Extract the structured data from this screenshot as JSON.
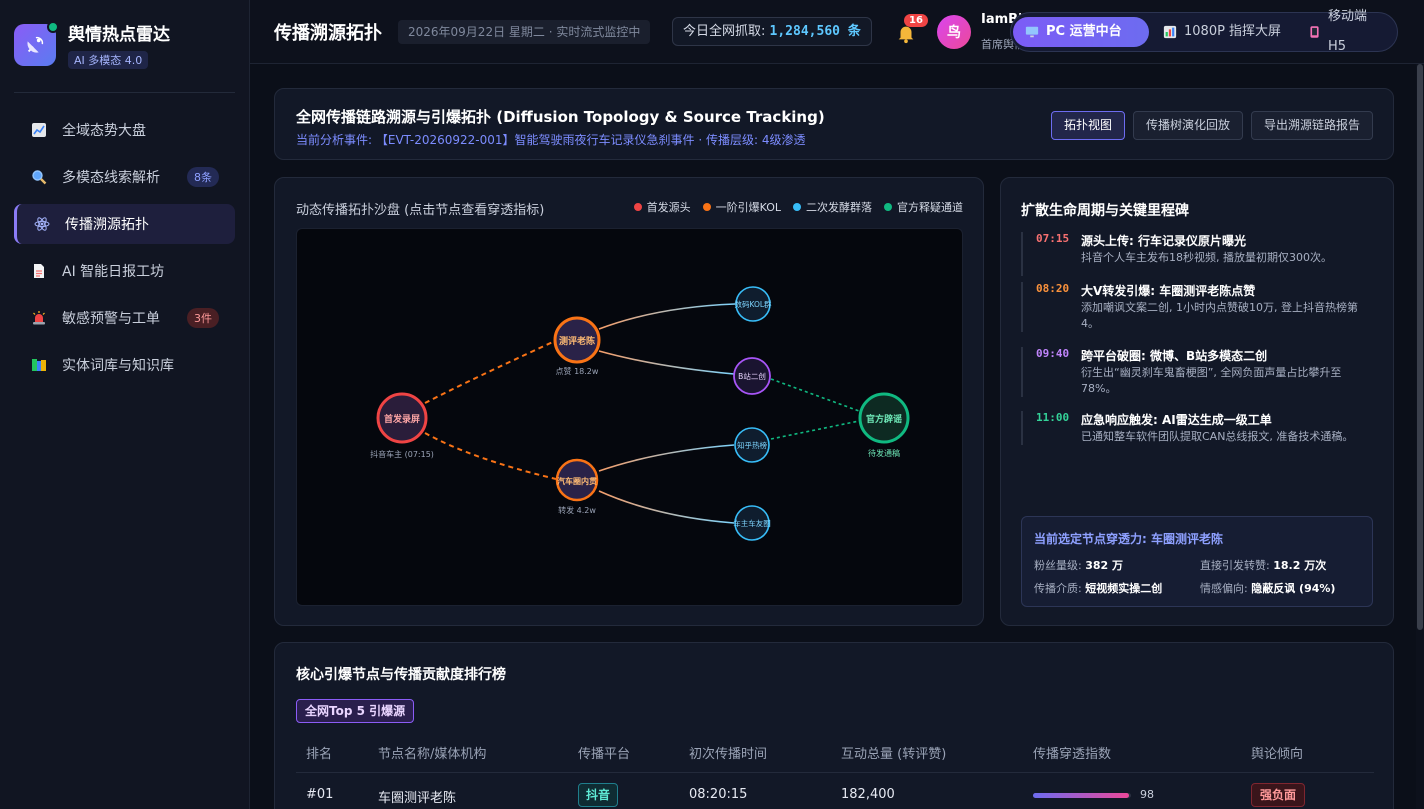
{
  "brand": {
    "title": "舆情热点雷达",
    "badge": "AI 多模态 4.0"
  },
  "nav": [
    {
      "label": "全域态势大盘",
      "icon": "chart-icon",
      "badge": ""
    },
    {
      "label": "多模态线索解析",
      "icon": "magnifier-icon",
      "badge": "8条"
    },
    {
      "label": "传播溯源拓扑",
      "icon": "atom-icon",
      "badge": ""
    },
    {
      "label": "AI 智能日报工坊",
      "icon": "document-icon",
      "badge": ""
    },
    {
      "label": "敏感预警与工单",
      "icon": "siren-icon",
      "badge": "3件"
    },
    {
      "label": "实体词库与知识库",
      "icon": "books-icon",
      "badge": ""
    }
  ],
  "header": {
    "title": "传播溯源拓扑",
    "date": "2026年09月22日 星期二 · 实时流式监控中",
    "count_label": "今日全网抓取:",
    "count_value": "1,284,560 条",
    "bell_count": "16",
    "avatar_text": "鸟",
    "user_name": "IamBird",
    "user_role": "首席舆情分析师"
  },
  "switcher": [
    {
      "label": "PC 运营中台",
      "icon": "monitor-icon"
    },
    {
      "label": "1080P 指挥大屏",
      "icon": "bar-chart-icon"
    },
    {
      "label": "移动端 H5",
      "icon": "phone-icon"
    }
  ],
  "head_card": {
    "title": "全网传播链路溯源与引爆拓扑 (Diffusion Topology & Source Tracking)",
    "subtitle": "当前分析事件: 【EVT-20260922-001】智能驾驶雨夜行车记录仪急刹事件 · 传播层级: 4级渗透",
    "btn_topology": "拓扑视图",
    "btn_replay": "传播树演化回放",
    "btn_export": "导出溯源链路报告"
  },
  "topology": {
    "title": "动态传播拓扑沙盘 (点击节点查看穿透指标)",
    "legend": [
      {
        "label": "首发源头",
        "color": "#ef4444"
      },
      {
        "label": "一阶引爆KOL",
        "color": "#f97316"
      },
      {
        "label": "二次发酵群落",
        "color": "#38bdf8"
      },
      {
        "label": "官方释疑通道",
        "color": "#10b981"
      }
    ],
    "nodes": {
      "source": {
        "label": "首发录屏",
        "caption": "抖音车主 (07:15)"
      },
      "kol1": {
        "label": "测评老陈",
        "caption": "点赞 18.2w"
      },
      "kol2": {
        "label": "汽车圈内贯",
        "caption": "转发 4.2w"
      },
      "g1": {
        "label": "数码KOL群"
      },
      "g2": {
        "label": "B站二创"
      },
      "g3": {
        "label": "知乎热榜"
      },
      "g4": {
        "label": "车主车友圈"
      },
      "official": {
        "label": "官方辟谣",
        "caption": "待发通稿"
      }
    }
  },
  "lifecycle": {
    "title": "扩散生命周期与关键里程碑",
    "milestones": [
      {
        "time": "07:15",
        "color": "#f87171",
        "title": "源头上传: 行车记录仪原片曝光",
        "desc": "抖音个人车主发布18秒视频, 播放量初期仅300次。"
      },
      {
        "time": "08:20",
        "color": "#fb923c",
        "title": "大V转发引爆: 车圈测评老陈点赞",
        "desc": "添加嘲讽文案二创, 1小时内点赞破10万, 登上抖音热榜第4。"
      },
      {
        "time": "09:40",
        "color": "#c084fc",
        "title": "跨平台破圈: 微博、B站多模态二创",
        "desc": "衍生出“幽灵刹车鬼畜梗图”, 全网负面声量占比攀升至78%。"
      },
      {
        "time": "11:00",
        "color": "#34d399",
        "title": "应急响应触发: AI雷达生成一级工单",
        "desc": "已通知整车软件团队提取CAN总线报文, 准备技术通稿。"
      }
    ],
    "detail": {
      "title": "当前选定节点穿透力: 车圈测评老陈",
      "fans_label": "粉丝量级:",
      "fans": "382 万",
      "reposts_label": "直接引发转赞:",
      "reposts": "18.2 万次",
      "medium_label": "传播介质:",
      "medium": "短视频实操二创",
      "sentiment_label": "情感偏向:",
      "sentiment": "隐蔽反讽 (94%)"
    }
  },
  "ranking": {
    "title": "核心引爆节点与传播贡献度排行榜",
    "tag": "全网Top 5 引爆源",
    "columns": [
      "排名",
      "节点名称/媒体机构",
      "传播平台",
      "初次传播时间",
      "互动总量 (转评赞)",
      "传播穿透指数",
      "舆论倾向"
    ],
    "rows": [
      {
        "rank": "#01",
        "name": "车圈测评老陈",
        "platform": "抖音",
        "time": "08:20:15",
        "interactions": "182,400",
        "index": 98,
        "index_text": "98",
        "sentiment": "强负面"
      }
    ]
  }
}
